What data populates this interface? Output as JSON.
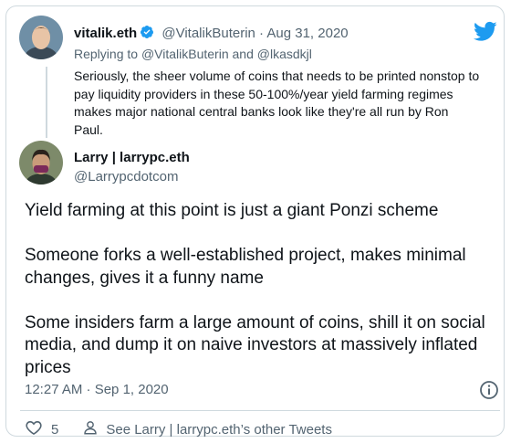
{
  "parent": {
    "name": "vitalik.eth",
    "handle": "@VitalikButerin",
    "separator": "·",
    "date": "Aug 31, 2020",
    "replying_label": "Replying to",
    "replying_user1": "@VitalikButerin",
    "replying_and": "and",
    "replying_user2": "@lkasdkjl",
    "text": "Seriously, the sheer volume of coins that needs to be printed nonstop to pay liquidity providers in these 50-100%/year yield farming regimes makes major national central banks look like they're all run by Ron Paul."
  },
  "tweet": {
    "name": "Larry | larrypc.eth",
    "handle": "@Larrypcdotcom",
    "paragraphs": [
      "Yield farming at this point is just a giant Ponzi scheme",
      "Someone forks a well-established project, makes minimal changes, gives it a funny name",
      "Some insiders farm a large amount of coins, shill it on social media, and dump it on naive investors at massively inflated prices"
    ],
    "timestamp": "12:27 AM · Sep 1, 2020"
  },
  "actions": {
    "like_count": "5",
    "other_tweets_label": "See Larry | larrypc.eth’s other Tweets"
  },
  "icons": {
    "brand": "twitter-bird-icon",
    "verified": "verified-badge-icon",
    "info": "info-icon",
    "like": "heart-icon",
    "profile": "person-icon"
  },
  "colors": {
    "twitter_blue": "#1d9bf0",
    "text": "#0f1419",
    "muted": "#536471",
    "border": "#cfd9de"
  }
}
